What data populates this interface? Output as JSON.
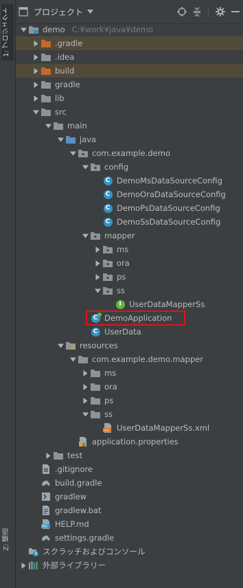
{
  "sidebar": {
    "project_tab": "1: プロジェクト",
    "structure_tab": "Z: 構造"
  },
  "header": {
    "title": "プロジェクト",
    "dropdown_icon": "triangle-down",
    "actions": [
      "locate-icon",
      "collapse-all-icon",
      "gear-icon",
      "hide-icon"
    ]
  },
  "tree": [
    {
      "label": "demo",
      "hint": "C:¥work¥java¥demo",
      "depth": 0,
      "arrow": "down",
      "icon": "folder-module"
    },
    {
      "label": ".gradle",
      "depth": 1,
      "arrow": "right",
      "icon": "folder-orange",
      "excluded": true
    },
    {
      "label": ".idea",
      "depth": 1,
      "arrow": "right",
      "icon": "folder"
    },
    {
      "label": "build",
      "depth": 1,
      "arrow": "right",
      "icon": "folder-orange",
      "excluded": true
    },
    {
      "label": "gradle",
      "depth": 1,
      "arrow": "right",
      "icon": "folder"
    },
    {
      "label": "lib",
      "depth": 1,
      "arrow": "right",
      "icon": "folder"
    },
    {
      "label": "src",
      "depth": 1,
      "arrow": "down",
      "icon": "folder"
    },
    {
      "label": "main",
      "depth": 2,
      "arrow": "down",
      "icon": "folder"
    },
    {
      "label": "java",
      "depth": 3,
      "arrow": "down",
      "icon": "folder-blue"
    },
    {
      "label": "com.example.demo",
      "depth": 4,
      "arrow": "down",
      "icon": "package"
    },
    {
      "label": "config",
      "depth": 5,
      "arrow": "down",
      "icon": "package"
    },
    {
      "label": "DemoMsDataSourceConfig",
      "depth": 6,
      "arrow": "none",
      "icon": "class"
    },
    {
      "label": "DemoOraDataSourceConfig",
      "depth": 6,
      "arrow": "none",
      "icon": "class"
    },
    {
      "label": "DemoPsDataSourceConfig",
      "depth": 6,
      "arrow": "none",
      "icon": "class"
    },
    {
      "label": "DemoSsDataSourceConfig",
      "depth": 6,
      "arrow": "none",
      "icon": "class"
    },
    {
      "label": "mapper",
      "depth": 5,
      "arrow": "down",
      "icon": "package"
    },
    {
      "label": "ms",
      "depth": 6,
      "arrow": "right",
      "icon": "package"
    },
    {
      "label": "ora",
      "depth": 6,
      "arrow": "right",
      "icon": "package"
    },
    {
      "label": "ps",
      "depth": 6,
      "arrow": "right",
      "icon": "package"
    },
    {
      "label": "ss",
      "depth": 6,
      "arrow": "down",
      "icon": "package"
    },
    {
      "label": "UserDataMapperSs",
      "depth": 7,
      "arrow": "none",
      "icon": "interface"
    },
    {
      "label": "DemoApplication",
      "depth": 5,
      "arrow": "none",
      "icon": "spring-class",
      "highlighted": true
    },
    {
      "label": "UserData",
      "depth": 5,
      "arrow": "none",
      "icon": "class"
    },
    {
      "label": "resources",
      "depth": 3,
      "arrow": "down",
      "icon": "folder-resources"
    },
    {
      "label": "com.example.demo.mapper",
      "depth": 4,
      "arrow": "down",
      "icon": "folder"
    },
    {
      "label": "ms",
      "depth": 5,
      "arrow": "right",
      "icon": "folder"
    },
    {
      "label": "ora",
      "depth": 5,
      "arrow": "right",
      "icon": "folder"
    },
    {
      "label": "ps",
      "depth": 5,
      "arrow": "right",
      "icon": "folder"
    },
    {
      "label": "ss",
      "depth": 5,
      "arrow": "down",
      "icon": "folder"
    },
    {
      "label": "UserDataMapperSs.xml",
      "depth": 6,
      "arrow": "none",
      "icon": "xml-file"
    },
    {
      "label": "application.properties",
      "depth": 4,
      "arrow": "none",
      "icon": "properties-file"
    },
    {
      "label": "test",
      "depth": 2,
      "arrow": "right",
      "icon": "folder"
    },
    {
      "label": ".gitignore",
      "depth": 1,
      "arrow": "none",
      "icon": "gitignore-file"
    },
    {
      "label": "build.gradle",
      "depth": 1,
      "arrow": "none",
      "icon": "gradle-file"
    },
    {
      "label": "gradlew",
      "depth": 1,
      "arrow": "none",
      "icon": "shell-file"
    },
    {
      "label": "gradlew.bat",
      "depth": 1,
      "arrow": "none",
      "icon": "text-file"
    },
    {
      "label": "HELP.md",
      "depth": 1,
      "arrow": "none",
      "icon": "markdown-file"
    },
    {
      "label": "settings.gradle",
      "depth": 1,
      "arrow": "none",
      "icon": "gradle-file"
    },
    {
      "label": "スクラッチおよびコンソール",
      "depth": 0,
      "arrow": "none",
      "icon": "scratch"
    },
    {
      "label": "外部ライブラリー",
      "depth": 0,
      "arrow": "right",
      "icon": "library"
    }
  ],
  "colors": {
    "background": "#3c3f41",
    "text": "#bbbbbb",
    "folder": "#8e9399",
    "folder_orange": "#c2692b",
    "class_blue": "#3592c4",
    "interface_green": "#62b543",
    "highlight_border": "#e0131c",
    "excluded_row": "#514a3a"
  }
}
